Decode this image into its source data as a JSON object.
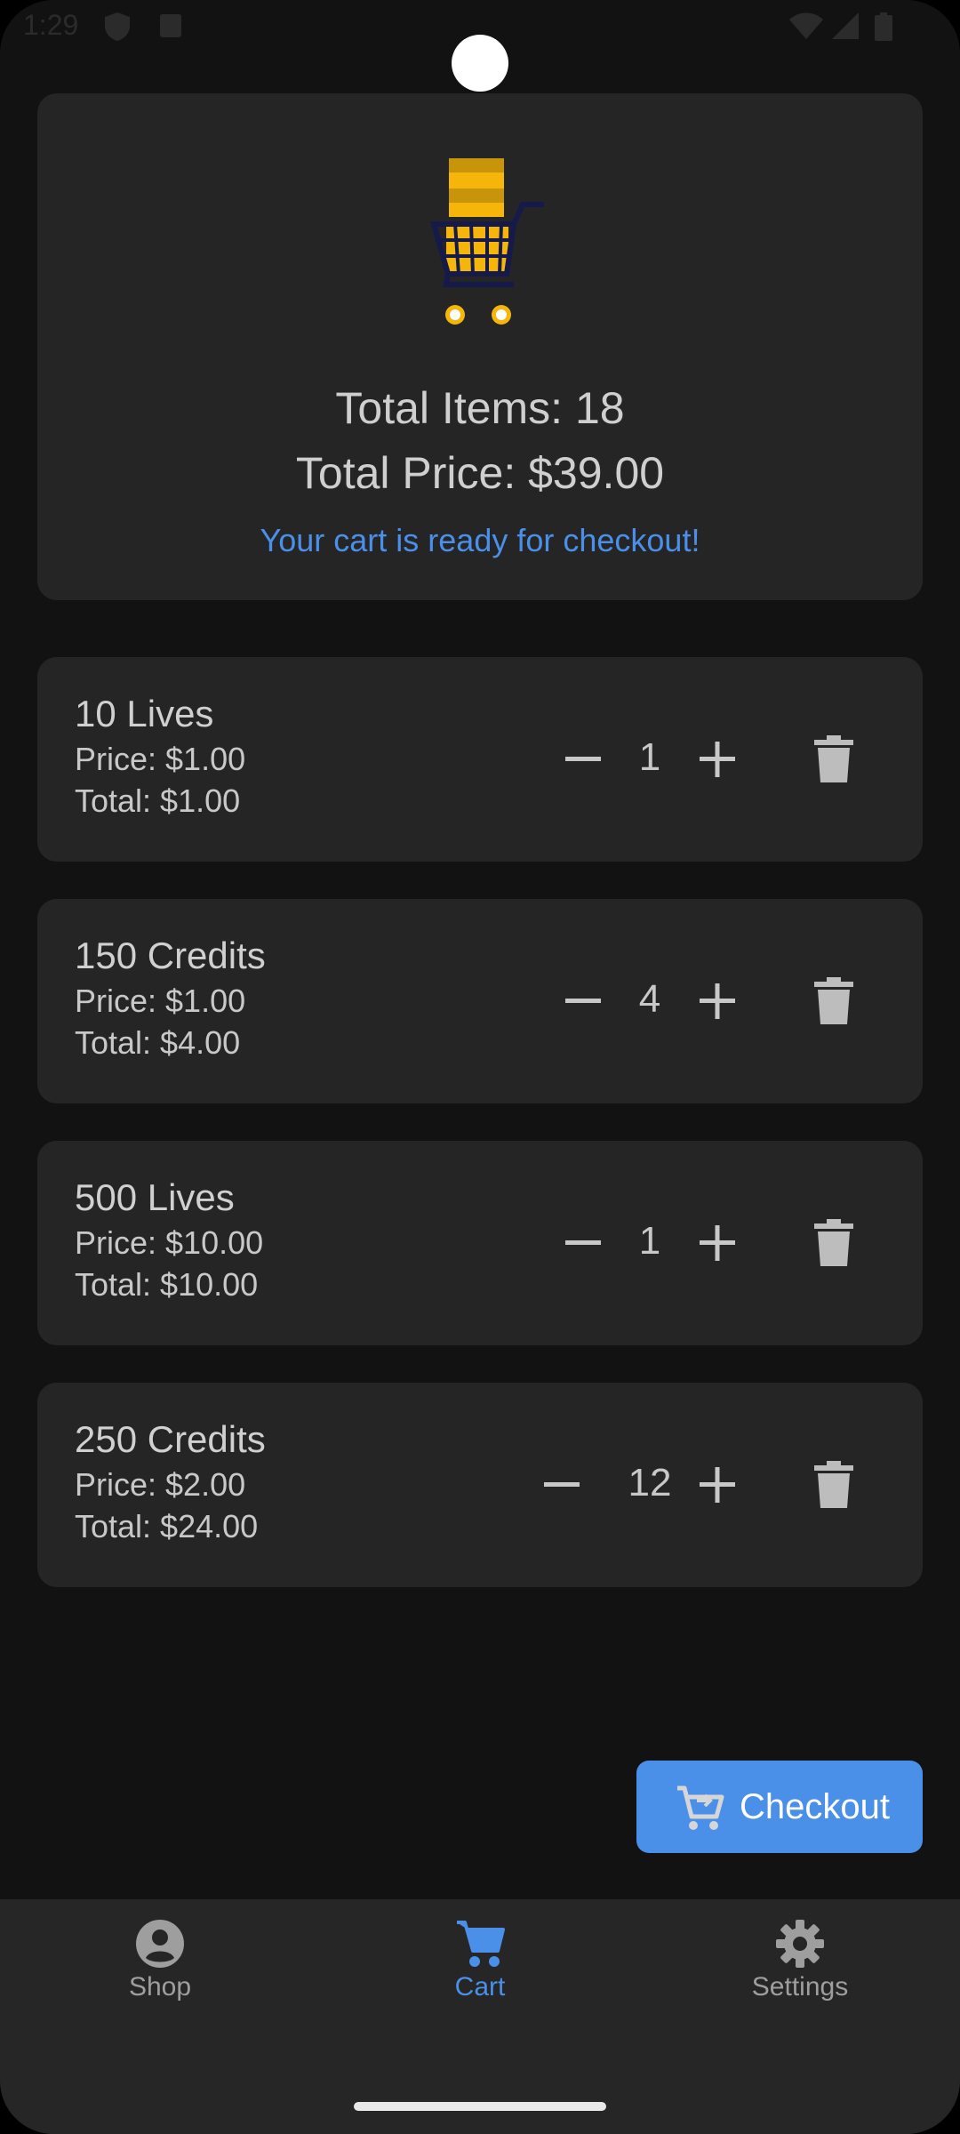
{
  "status_bar": {
    "time": "1:29"
  },
  "summary": {
    "total_items": "Total Items: 18",
    "total_price": "Total Price: $39.00",
    "message": "Your cart is ready for checkout!"
  },
  "items": [
    {
      "name": "10 Lives",
      "price": "Price: $1.00",
      "total": "Total: $1.00",
      "quantity": "1"
    },
    {
      "name": "150 Credits",
      "price": "Price: $1.00",
      "total": "Total: $4.00",
      "quantity": "4"
    },
    {
      "name": "500 Lives",
      "price": "Price: $10.00",
      "total": "Total: $10.00",
      "quantity": "1"
    },
    {
      "name": "250 Credits",
      "price": "Price: $2.00",
      "total": "Total: $24.00",
      "quantity": "12"
    }
  ],
  "checkout": {
    "label": "Checkout",
    "icon": "cart-arrow-down-icon"
  },
  "nav": {
    "items": [
      {
        "label": "Shop",
        "icon": "account-circle-icon",
        "active": false
      },
      {
        "label": "Cart",
        "icon": "shopping-cart-icon",
        "active": true
      },
      {
        "label": "Settings",
        "icon": "gear-icon",
        "active": false
      }
    ]
  },
  "colors": {
    "background": "#121212",
    "card": "#252525",
    "accent": "#4a8fe8",
    "text": "#cfcfcf"
  }
}
